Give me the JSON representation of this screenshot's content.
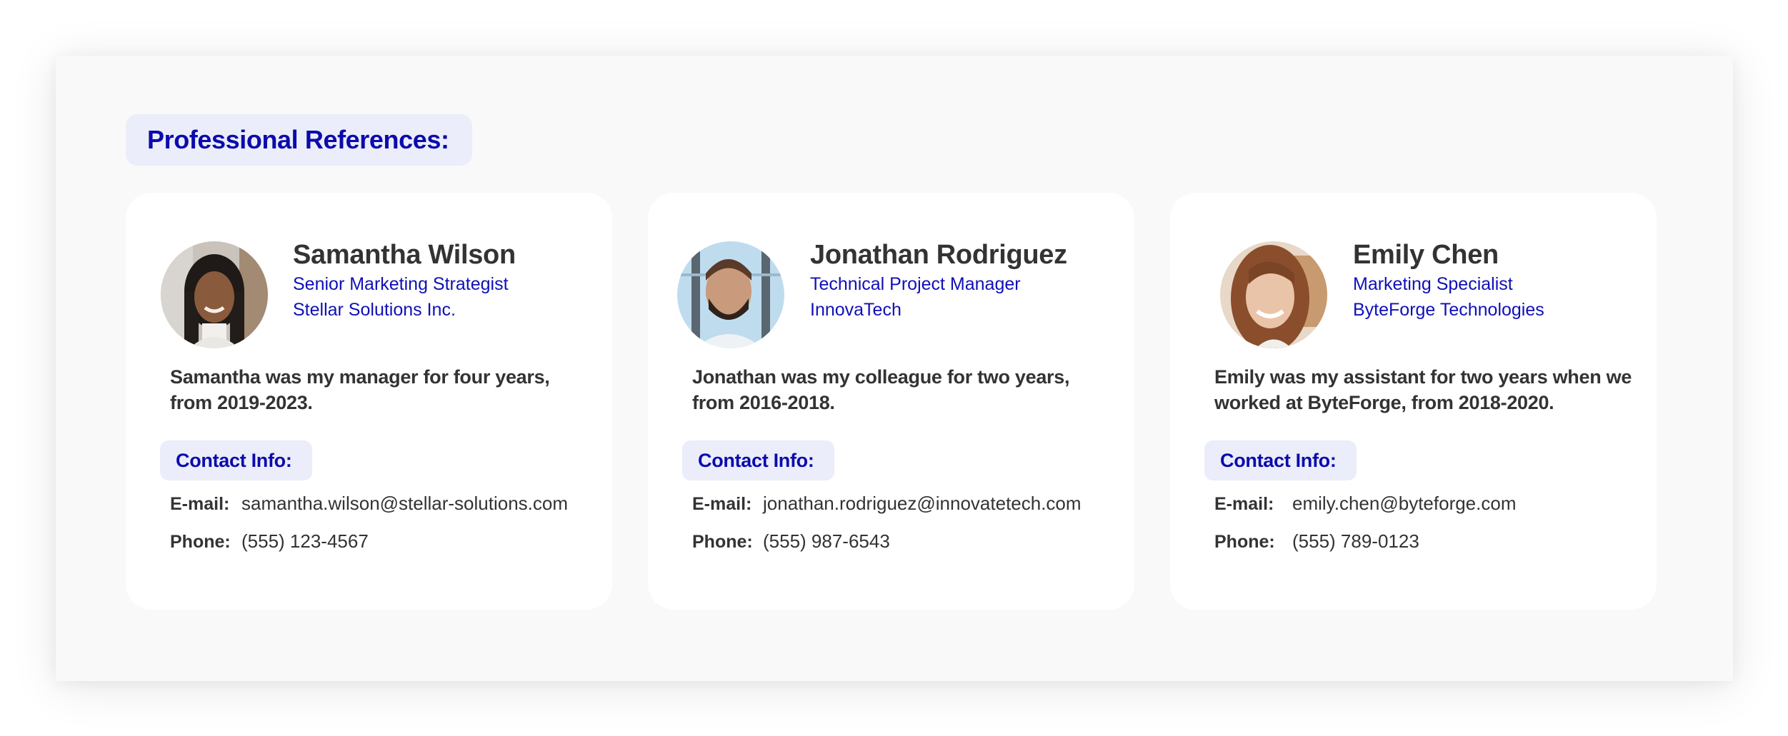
{
  "section": {
    "title": "Professional References:"
  },
  "colors": {
    "accent": "#0b0bac",
    "badge_bg": "#ebedfa",
    "text": "#333333",
    "card_bg": "#ffffff",
    "page_bg": "#f9f9f9"
  },
  "references": [
    {
      "name": "Samantha Wilson",
      "title": "Senior Marketing Strategist",
      "company": "Stellar Solutions Inc.",
      "description": "Samantha was my manager for four years, from 2019-2023.",
      "contact_label": "Contact Info:",
      "email_label": "E-mail:",
      "email": "samantha.wilson@stellar-solutions.com",
      "phone_label": "Phone:",
      "phone": "(555) 123-4567",
      "avatar_icon": "person-photo-icon"
    },
    {
      "name": "Jonathan Rodriguez",
      "title": "Technical Project Manager",
      "company": "InnovaTech",
      "description": "Jonathan was my colleague for two years, from 2016-2018.",
      "contact_label": "Contact Info:",
      "email_label": "E-mail:",
      "email": "jonathan.rodriguez@innovatetech.com",
      "phone_label": "Phone:",
      "phone": "(555) 987-6543",
      "avatar_icon": "person-photo-icon"
    },
    {
      "name": "Emily Chen",
      "title": "Marketing Specialist",
      "company": "ByteForge Technologies",
      "description": "Emily was my assistant for two years when we worked at ByteForge, from 2018-2020.",
      "contact_label": "Contact Info:",
      "email_label": "E-mail:",
      "email": "emily.chen@byteforge.com",
      "phone_label": "Phone:",
      "phone": "(555) 789-0123",
      "avatar_icon": "person-photo-icon"
    }
  ]
}
